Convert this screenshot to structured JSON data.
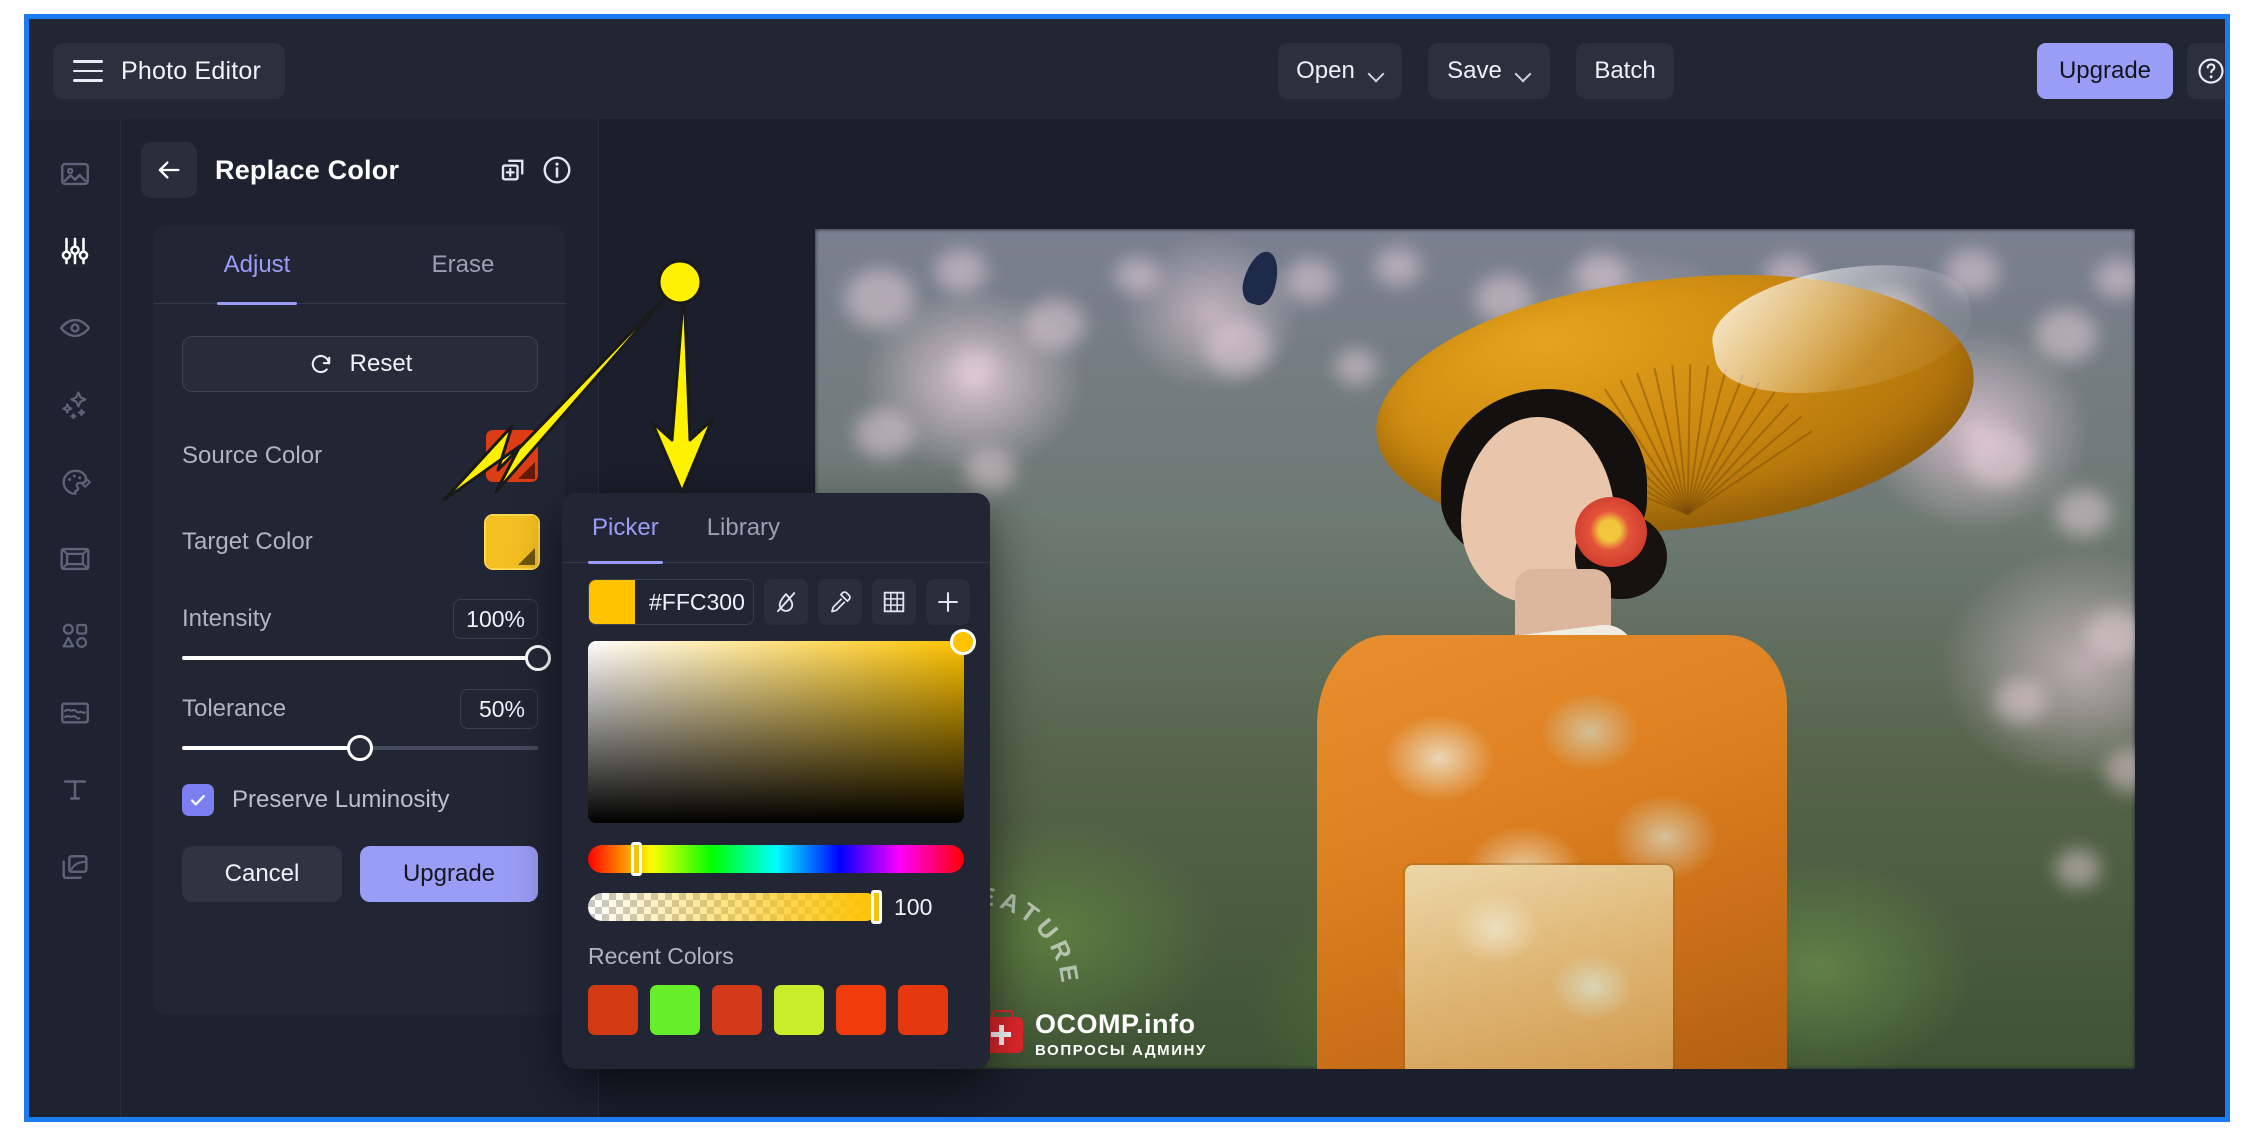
{
  "app": {
    "title": "Photo Editor",
    "menu_icon": "hamburger-icon"
  },
  "toolbar": {
    "open_label": "Open",
    "save_label": "Save",
    "batch_label": "Batch",
    "upgrade_label": "Upgrade",
    "help_icon": "question-mark-circle-icon"
  },
  "sidebar": {
    "items": [
      {
        "name": "image",
        "icon": "image-icon",
        "active": false
      },
      {
        "name": "adjustments",
        "icon": "sliders-icon",
        "active": true
      },
      {
        "name": "retouch",
        "icon": "eye-icon",
        "active": false
      },
      {
        "name": "effects",
        "icon": "sparkles-icon",
        "active": false
      },
      {
        "name": "paint",
        "icon": "palette-icon",
        "active": false
      },
      {
        "name": "frame",
        "icon": "frame-icon",
        "active": false
      },
      {
        "name": "shapes",
        "icon": "shapes-icon",
        "active": false
      },
      {
        "name": "texture",
        "icon": "texture-icon",
        "active": false
      },
      {
        "name": "text",
        "icon": "text-icon",
        "active": false
      },
      {
        "name": "layers",
        "icon": "layers-icon",
        "active": false
      }
    ]
  },
  "panel": {
    "back_icon": "arrow-left-icon",
    "title": "Replace Color",
    "duplicate_icon": "add-layer-icon",
    "info_icon": "info-circle-icon",
    "tabs": [
      {
        "label": "Adjust",
        "active": true
      },
      {
        "label": "Erase",
        "active": false
      }
    ],
    "reset_label": "Reset",
    "reset_icon": "refresh-icon",
    "source_color": {
      "label": "Source Color",
      "value": "#DD3D14"
    },
    "target_color": {
      "label": "Target Color",
      "value": "#F5C022"
    },
    "intensity": {
      "label": "Intensity",
      "value": "100%",
      "percent": 100
    },
    "tolerance": {
      "label": "Tolerance",
      "value": "50%",
      "percent": 50
    },
    "preserve_luminosity": {
      "label": "Preserve Luminosity",
      "checked": true
    },
    "cancel_label": "Cancel",
    "upgrade_label": "Upgrade"
  },
  "picker": {
    "tabs": [
      {
        "label": "Picker",
        "active": true
      },
      {
        "label": "Library",
        "active": false
      }
    ],
    "hex_value": "#FFC300",
    "swatch_color": "#FFC300",
    "tools": [
      {
        "name": "no-color",
        "icon": "no-color-slash-icon"
      },
      {
        "name": "eyedropper",
        "icon": "eyedropper-icon"
      },
      {
        "name": "palette-grid",
        "icon": "grid-icon"
      },
      {
        "name": "add-color",
        "icon": "plus-icon"
      }
    ],
    "hue_percent": 13,
    "alpha_value": "100",
    "alpha_percent": 100,
    "recent_label": "Recent Colors",
    "recent_colors": [
      "#D23A14",
      "#66EE2A",
      "#D23A19",
      "#C9ED2B",
      "#F23B0B",
      "#E6380E"
    ]
  },
  "canvas": {
    "watermark_ring_text": "PLUS FEATURE",
    "watermark_brand": "OCOMP.info",
    "watermark_sub": "ВОПРОСЫ АДМИНУ"
  },
  "colors": {
    "accent_purple": "#9A9DF5",
    "window_border_blue": "#1A7CF0",
    "annotation_yellow": "#FFF200",
    "panel_bg": "#222533",
    "app_bg": "#1E2130"
  }
}
